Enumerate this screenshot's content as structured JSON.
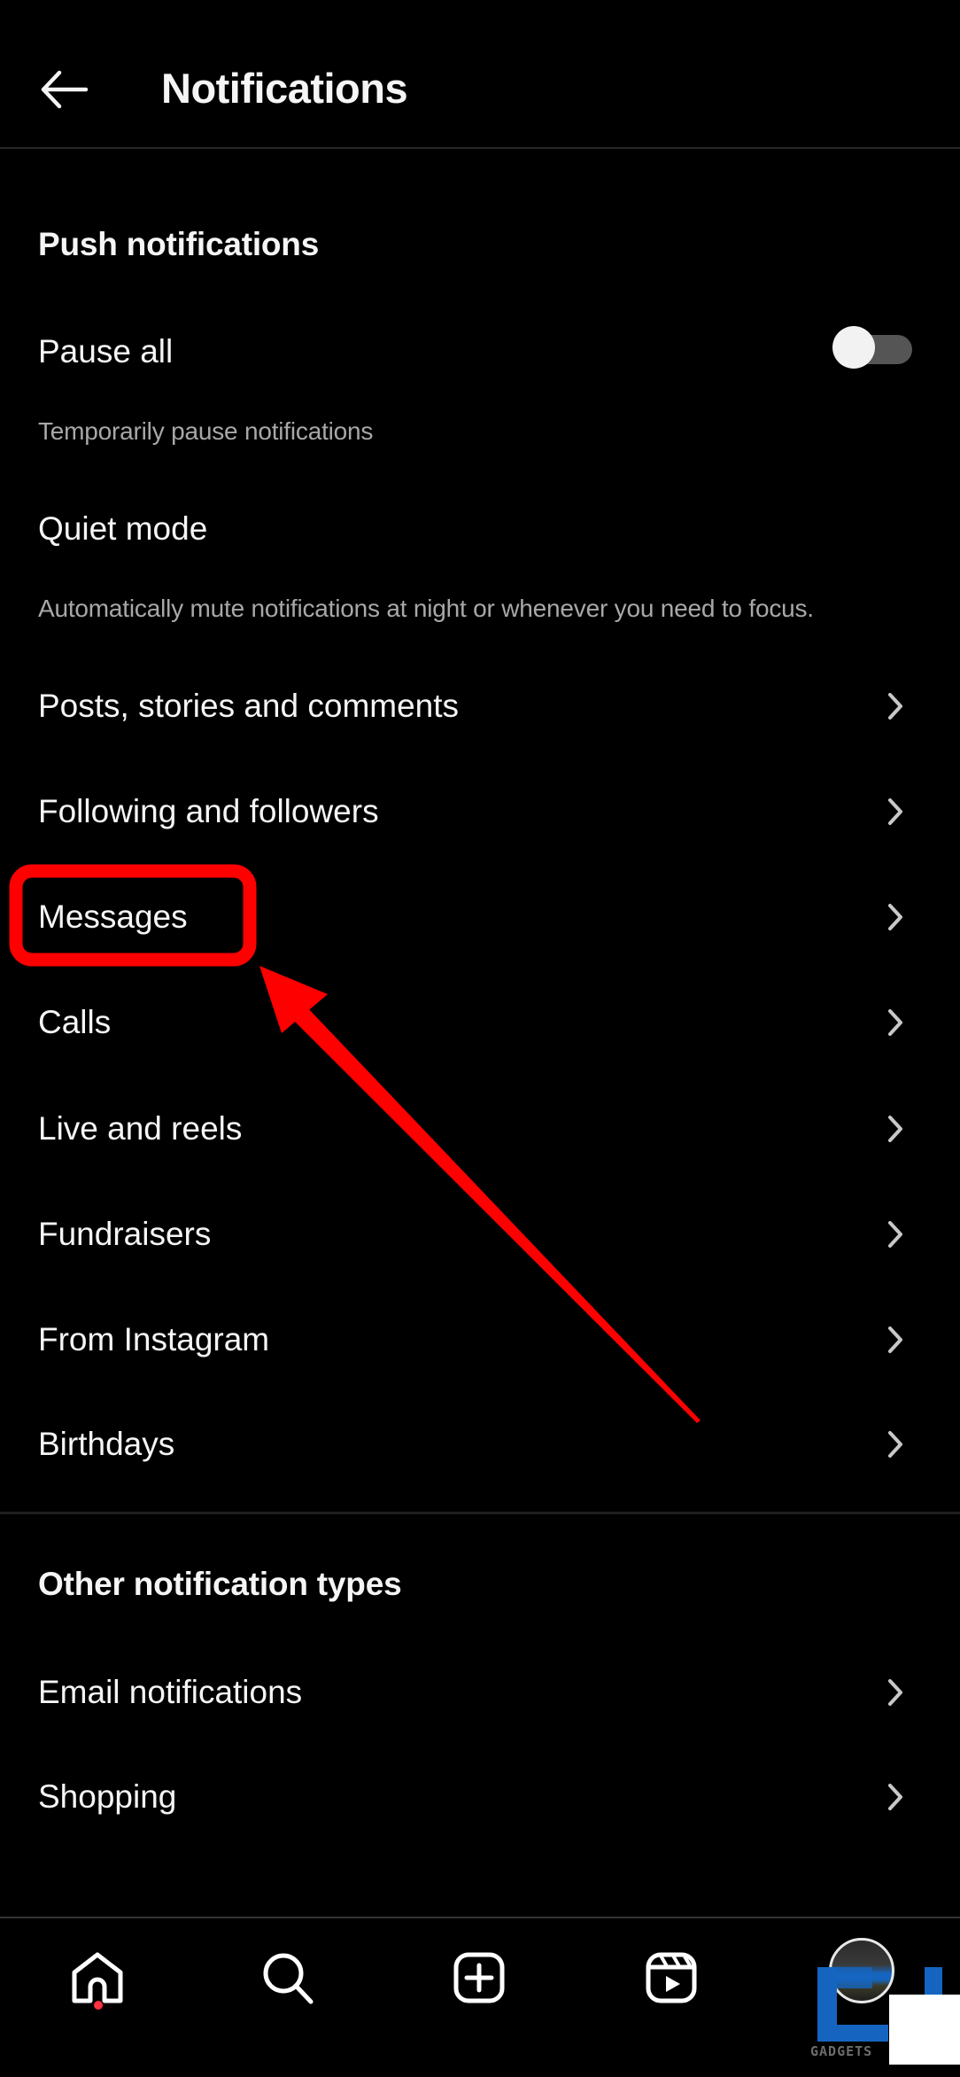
{
  "header": {
    "back_icon": "arrow-left-icon",
    "title": "Notifications"
  },
  "push_section": {
    "title": "Push notifications",
    "pause_all": {
      "label": "Pause all",
      "description": "Temporarily pause notifications",
      "toggle_on": false
    },
    "quiet_mode": {
      "label": "Quiet mode",
      "description": "Automatically mute notifications at night or whenever you need to focus."
    },
    "items": [
      {
        "label": "Posts, stories and comments",
        "icon": "chevron-right-icon"
      },
      {
        "label": "Following and followers",
        "icon": "chevron-right-icon"
      },
      {
        "label": "Messages",
        "icon": "chevron-right-icon",
        "highlighted": true
      },
      {
        "label": "Calls",
        "icon": "chevron-right-icon"
      },
      {
        "label": "Live and reels",
        "icon": "chevron-right-icon"
      },
      {
        "label": "Fundraisers",
        "icon": "chevron-right-icon"
      },
      {
        "label": "From Instagram",
        "icon": "chevron-right-icon"
      },
      {
        "label": "Birthdays",
        "icon": "chevron-right-icon"
      }
    ]
  },
  "other_section": {
    "title": "Other notification types",
    "items": [
      {
        "label": "Email notifications",
        "icon": "chevron-right-icon"
      },
      {
        "label": "Shopping",
        "icon": "chevron-right-icon"
      }
    ]
  },
  "bottom_nav": {
    "items": [
      {
        "name": "home",
        "icon": "home-icon",
        "has_notification": true
      },
      {
        "name": "search",
        "icon": "search-icon"
      },
      {
        "name": "create",
        "icon": "plus-square-icon"
      },
      {
        "name": "reels",
        "icon": "reels-icon"
      },
      {
        "name": "profile",
        "icon": "avatar"
      }
    ]
  },
  "annotation": {
    "highlight_target": "Messages",
    "color": "#ff0000"
  },
  "watermark": {
    "text": "GADGETS"
  },
  "colors": {
    "background": "#000000",
    "text_primary": "#f5f5f5",
    "text_secondary": "#a8a8a8",
    "divider": "#262626",
    "toggle_track": "#555555",
    "notification_dot": "#ff3040",
    "annotation_red": "#ff0000",
    "watermark_blue": "#1565c0"
  }
}
